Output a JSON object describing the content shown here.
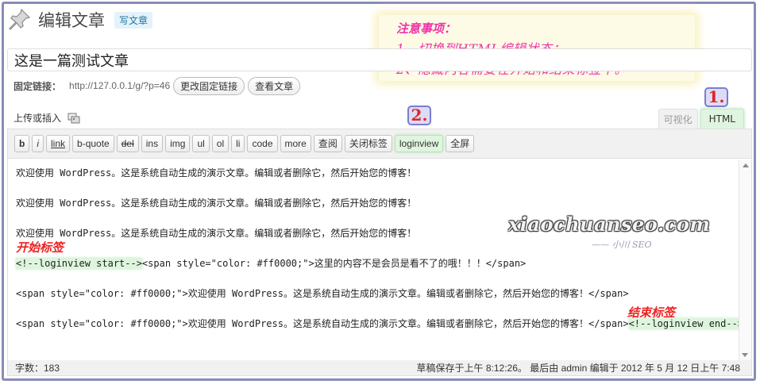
{
  "header": {
    "page_title": "编辑文章",
    "write_button": "写文章"
  },
  "notice": {
    "title": "注意事项：",
    "line1": "1、切换到HTML编辑状态；",
    "line2": "2、隐藏内容需要在开始和结束标签中。"
  },
  "post": {
    "title": "这是一篇测试文章"
  },
  "permalink": {
    "label": "固定链接：",
    "url": "http://127.0.0.1/g/?p=46",
    "change_button": "更改固定链接",
    "view_button": "查看文章"
  },
  "upload": {
    "label": "上传或插入"
  },
  "tabs": {
    "visual": "可视化",
    "html": "HTML"
  },
  "badges": {
    "one": "1.",
    "two": "2."
  },
  "toolbar": {
    "buttons": [
      "b",
      "i",
      "link",
      "b-quote",
      "del",
      "ins",
      "img",
      "ul",
      "ol",
      "li",
      "code",
      "more",
      "查阅",
      "关闭标签",
      "loginview",
      "全屏"
    ]
  },
  "content": {
    "p1": "欢迎使用 WordPress。这是系统自动生成的演示文章。编辑或者删除它，然后开始您的博客！",
    "p2": "欢迎使用 WordPress。这是系统自动生成的演示文章。编辑或者删除它，然后开始您的博客！",
    "p3": "欢迎使用 WordPress。这是系统自动生成的演示文章。编辑或者删除它，然后开始您的博客！",
    "p4_tag": "<!--loginview start-->",
    "p4_rest": "<span style=\"color: #ff0000;\">这里的内容不是会员是看不了的哦！！！</span>",
    "p5": "<span style=\"color: #ff0000;\">欢迎使用 WordPress。这是系统自动生成的演示文章。编辑或者删除它，然后开始您的博客！</span>",
    "p6_main": "<span style=\"color: #ff0000;\">欢迎使用 WordPress。这是系统自动生成的演示文章。编辑或者删除它，然后开始您的博客！</span>",
    "p6_tag": "<!--loginview end-->"
  },
  "annotations": {
    "start": "开始标签",
    "end": "结束标签"
  },
  "watermark": {
    "site": "xiaochuanseo.com",
    "sub": "—— 小川 SEO"
  },
  "status": {
    "word_count": "字数：183",
    "saved": "草稿保存于上午 8:12:26。 最后由 admin 编辑于 2012 年 5 月 12 日上午 7:48"
  },
  "colors": {
    "accent_pink": "#ee33a6",
    "annotation_red": "#ee2222",
    "highlight_green": "#dff5df",
    "frame_border": "#8a8cb8"
  }
}
